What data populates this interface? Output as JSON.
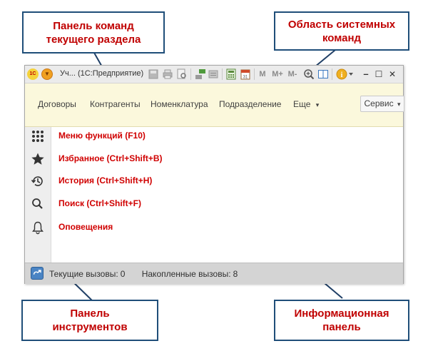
{
  "callouts": {
    "section_commands_line1": "Панель команд",
    "section_commands_line2": "текущего раздела",
    "system_commands_line1": "Область системных",
    "system_commands_line2": "команд",
    "toolbar_line1": "Панель",
    "toolbar_line2": "инструментов",
    "info_panel_line1": "Информационная",
    "info_panel_line2": "панель"
  },
  "window": {
    "logo_text": "1С",
    "title": "Уч...  (1С:Предприятие)",
    "system_buttons": [
      "M",
      "M+",
      "M-"
    ],
    "close_glyph": "✕",
    "minimize_glyph": "–",
    "maximize_glyph": "☐"
  },
  "command_bar": {
    "items": [
      "Договоры",
      "Контрагенты",
      "Номенклатура",
      "Подразделение",
      "Еще"
    ],
    "more_caret": "▾",
    "service_label": "Сервис",
    "service_caret": "▾"
  },
  "tools": {
    "items": [
      "Меню функций (F10)",
      "Избранное (Ctrl+Shift+B)",
      "История (Ctrl+Shift+H)",
      "Поиск (Ctrl+Shift+F)",
      "Оповещения"
    ]
  },
  "info_bar": {
    "current_calls_label": "Текущие вызовы:",
    "current_calls_value": "0",
    "accum_calls_label": "Накопленные вызовы:",
    "accum_calls_value": "8"
  },
  "colors": {
    "callout_text": "#c00000",
    "callout_border": "#1f4e79",
    "leader_line": "#1f3f66",
    "command_bar_bg": "#fbf8dc",
    "tool_text": "#d00000"
  },
  "icons": {
    "toolbar": [
      "grid-icon",
      "star-icon",
      "history-icon",
      "search-icon",
      "bell-icon"
    ],
    "info": "info-panel-icon"
  }
}
